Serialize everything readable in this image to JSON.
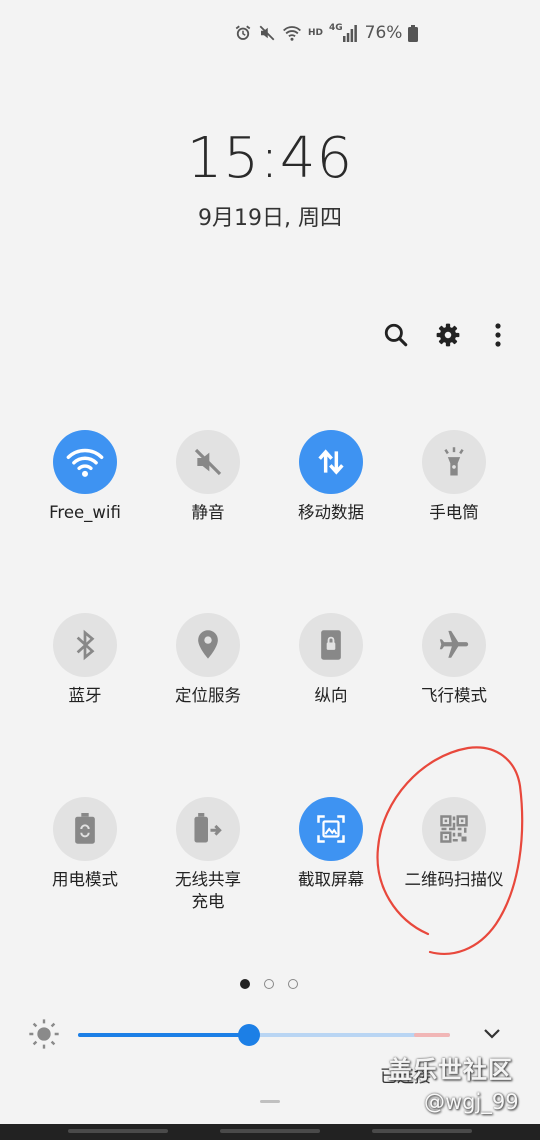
{
  "status_bar": {
    "icons": [
      "alarm-icon",
      "mute-icon",
      "wifi-icon",
      "hd-icon",
      "4g-signal-icon",
      "battery-icon"
    ],
    "hd_label": "HD",
    "net_label": "4G",
    "battery": "76%"
  },
  "clock": {
    "time": "15:46",
    "date": "9月19日, 周四"
  },
  "toolbar": {
    "items": [
      "search-icon",
      "settings-gear-icon",
      "more-options-icon"
    ]
  },
  "quick_settings": {
    "tiles": [
      {
        "label": "Free_wifi",
        "icon": "wifi-icon",
        "active": true
      },
      {
        "label": "静音",
        "icon": "mute-icon",
        "active": false
      },
      {
        "label": "移动数据",
        "icon": "mobile-data-icon",
        "active": true
      },
      {
        "label": "手电筒",
        "icon": "flashlight-icon",
        "active": false
      },
      {
        "label": "蓝牙",
        "icon": "bluetooth-icon",
        "active": false
      },
      {
        "label": "定位服务",
        "icon": "location-icon",
        "active": false
      },
      {
        "label": "纵向",
        "icon": "portrait-lock-icon",
        "active": false
      },
      {
        "label": "飞行模式",
        "icon": "airplane-icon",
        "active": false
      },
      {
        "label": "用电模式",
        "icon": "power-mode-icon",
        "active": false
      },
      {
        "label": "无线共享\n充电",
        "icon": "wireless-powershare-icon",
        "active": false
      },
      {
        "label": "截取屏幕",
        "icon": "screenshot-icon",
        "active": true
      },
      {
        "label": "二维码扫描仪",
        "icon": "qr-scanner-icon",
        "active": false
      }
    ]
  },
  "pagination": {
    "pages": 3,
    "current": 1
  },
  "brightness": {
    "level": 0.46
  },
  "partial_text": "已连接",
  "watermark": {
    "line1": "盖乐世社区",
    "line2": "@wgj_99"
  },
  "colors": {
    "accent": "#3e93f2",
    "tile_off": "#e2e2e2",
    "annotation": "#e8483c"
  }
}
